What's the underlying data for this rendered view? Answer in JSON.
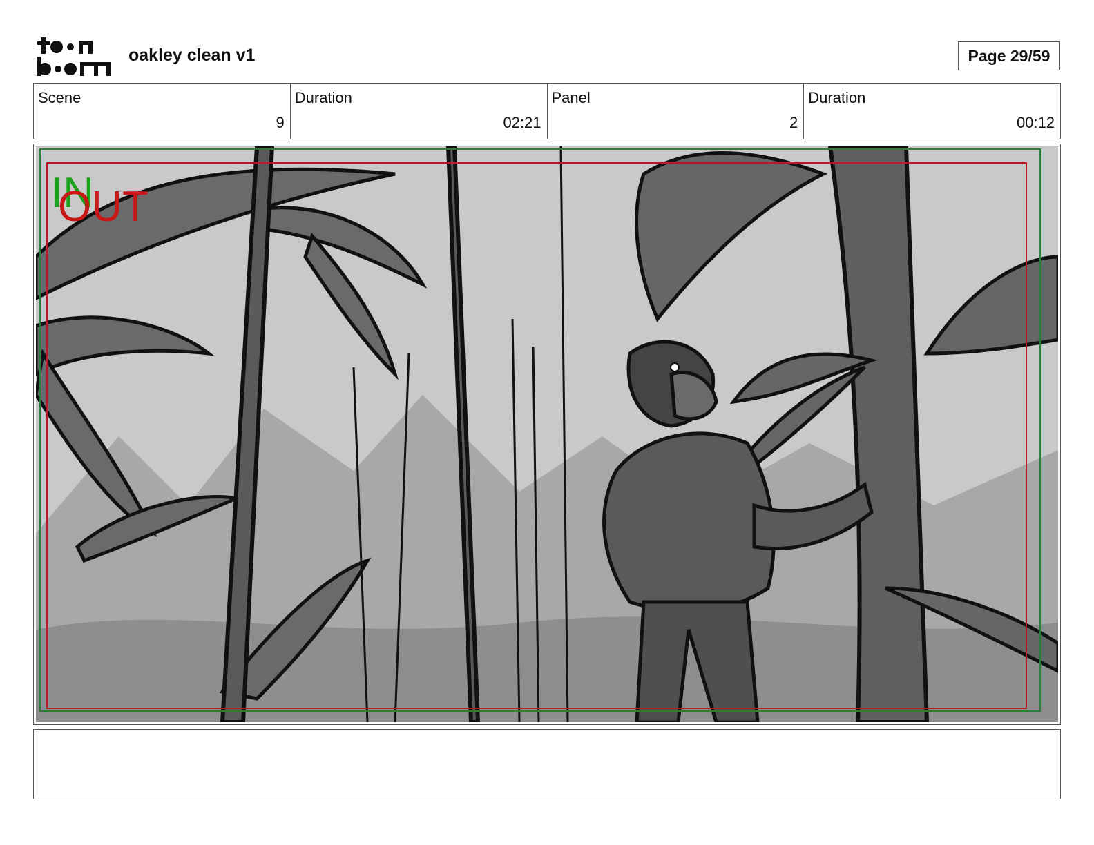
{
  "header": {
    "logo_text": "toon boom",
    "project_title": "oakley clean v1",
    "page_label": "Page 29/59"
  },
  "info": {
    "scene_label": "Scene",
    "scene_value": "9",
    "scene_duration_label": "Duration",
    "scene_duration_value": "02:21",
    "panel_label": "Panel",
    "panel_value": "2",
    "panel_duration_label": "Duration",
    "panel_duration_value": "00:12"
  },
  "panel": {
    "in_marker": "IN",
    "out_marker": "OUT",
    "colors": {
      "in_marker": "#1aa31a",
      "out_marker": "#c81818",
      "safe_area_green": "#2e7d32",
      "safe_area_red": "#b71c1c",
      "sky": "#c9c9c9",
      "mid": "#9a9a9a",
      "dark": "#666666"
    }
  },
  "notes": {
    "text": ""
  }
}
